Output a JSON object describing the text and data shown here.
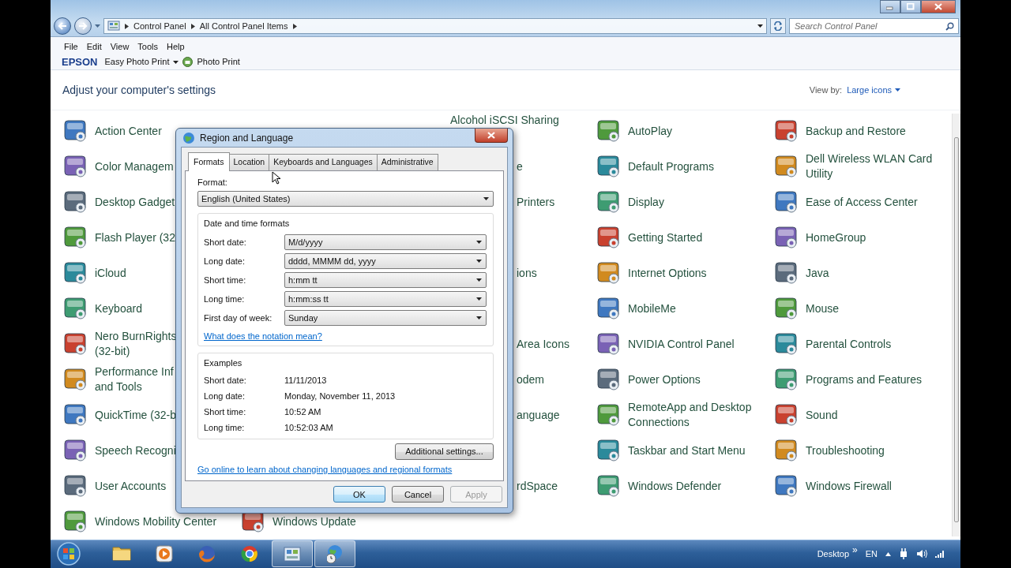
{
  "address_bar": {
    "crumbs": [
      "Control Panel",
      "All Control Panel Items"
    ],
    "search_placeholder": "Search Control Panel"
  },
  "menu": [
    "File",
    "Edit",
    "View",
    "Tools",
    "Help"
  ],
  "toolbar": {
    "brand": "EPSON",
    "items": [
      "Easy Photo Print",
      "Photo Print"
    ]
  },
  "header": {
    "title": "Adjust your computer's settings",
    "view_by_label": "View by:",
    "view_by_value": "Large icons"
  },
  "rows": [
    {
      "cells": [
        {
          "kind": "item",
          "label": "Action Center"
        },
        {
          "kind": "covered"
        },
        {
          "kind": "peek",
          "label": "Alcohol iSCSI Sharing"
        },
        {
          "kind": "item",
          "label": "AutoPlay"
        },
        {
          "kind": "item",
          "label": "Backup and Restore"
        }
      ]
    },
    {
      "cells": [
        {
          "kind": "item",
          "label": "Color Managem"
        },
        {
          "kind": "covered"
        },
        {
          "kind": "partial",
          "label": "e"
        },
        {
          "kind": "item",
          "label": "Default Programs"
        },
        {
          "kind": "item",
          "label": "Dell Wireless WLAN Card\nUtility"
        }
      ]
    },
    {
      "cells": [
        {
          "kind": "item",
          "label": "Desktop Gadget"
        },
        {
          "kind": "covered"
        },
        {
          "kind": "partial",
          "label": "Printers"
        },
        {
          "kind": "item",
          "label": "Display"
        },
        {
          "kind": "item",
          "label": "Ease of Access Center"
        }
      ]
    },
    {
      "cells": [
        {
          "kind": "item",
          "label": "Flash Player (32"
        },
        {
          "kind": "covered"
        },
        {
          "kind": "covered"
        },
        {
          "kind": "item",
          "label": "Getting Started"
        },
        {
          "kind": "item",
          "label": "HomeGroup"
        }
      ]
    },
    {
      "cells": [
        {
          "kind": "item",
          "label": "iCloud"
        },
        {
          "kind": "covered"
        },
        {
          "kind": "partial",
          "label": "ions"
        },
        {
          "kind": "item",
          "label": "Internet Options"
        },
        {
          "kind": "item",
          "label": "Java"
        }
      ]
    },
    {
      "cells": [
        {
          "kind": "item",
          "label": "Keyboard"
        },
        {
          "kind": "covered"
        },
        {
          "kind": "covered"
        },
        {
          "kind": "item",
          "label": "MobileMe"
        },
        {
          "kind": "item",
          "label": "Mouse"
        }
      ]
    },
    {
      "cells": [
        {
          "kind": "item",
          "label": "Nero BurnRights\n(32-bit)"
        },
        {
          "kind": "covered"
        },
        {
          "kind": "partial",
          "label": "Area Icons"
        },
        {
          "kind": "item",
          "label": "NVIDIA Control Panel"
        },
        {
          "kind": "item",
          "label": "Parental Controls"
        }
      ]
    },
    {
      "cells": [
        {
          "kind": "item",
          "label": "Performance Inf\nand Tools"
        },
        {
          "kind": "covered"
        },
        {
          "kind": "partial",
          "label": "odem"
        },
        {
          "kind": "item",
          "label": "Power Options"
        },
        {
          "kind": "item",
          "label": "Programs and Features"
        }
      ]
    },
    {
      "cells": [
        {
          "kind": "item",
          "label": "QuickTime (32-b"
        },
        {
          "kind": "covered"
        },
        {
          "kind": "partial",
          "label": "anguage"
        },
        {
          "kind": "item",
          "label": "RemoteApp and Desktop\nConnections"
        },
        {
          "kind": "item",
          "label": "Sound"
        }
      ]
    },
    {
      "cells": [
        {
          "kind": "item",
          "label": "Speech Recogni"
        },
        {
          "kind": "covered"
        },
        {
          "kind": "covered"
        },
        {
          "kind": "item",
          "label": "Taskbar and Start Menu"
        },
        {
          "kind": "item",
          "label": "Troubleshooting"
        }
      ]
    },
    {
      "cells": [
        {
          "kind": "item",
          "label": "User Accounts"
        },
        {
          "kind": "covered"
        },
        {
          "kind": "partial",
          "label": "rdSpace"
        },
        {
          "kind": "item",
          "label": "Windows Defender"
        },
        {
          "kind": "item",
          "label": "Windows Firewall"
        }
      ]
    },
    {
      "cells": [
        {
          "kind": "item",
          "label": "Windows Mobility Center"
        },
        {
          "kind": "item",
          "label": "Windows Update"
        }
      ]
    }
  ],
  "dialog": {
    "title": "Region and Language",
    "tabs": [
      {
        "label": "Formats",
        "selected": true
      },
      {
        "label": "Location",
        "selected": false
      },
      {
        "label": "Keyboards and Languages",
        "selected": false
      },
      {
        "label": "Administrative",
        "selected": false
      }
    ],
    "format_label": "Format:",
    "format_value": "English (United States)",
    "formats_group": {
      "title": "Date and time formats",
      "rows": [
        {
          "label": "Short date:",
          "value": "M/d/yyyy"
        },
        {
          "label": "Long date:",
          "value": "dddd, MMMM dd, yyyy"
        },
        {
          "label": "Short time:",
          "value": "h:mm tt"
        },
        {
          "label": "Long time:",
          "value": "h:mm:ss tt"
        },
        {
          "label": "First day of week:",
          "value": "Sunday"
        }
      ]
    },
    "notation_link": "What does the notation mean?",
    "examples_group": {
      "title": "Examples",
      "rows": [
        {
          "label": "Short date:",
          "value": "11/11/2013"
        },
        {
          "label": "Long date:",
          "value": "Monday, November 11, 2013"
        },
        {
          "label": "Short time:",
          "value": "10:52 AM"
        },
        {
          "label": "Long time:",
          "value": "10:52:03 AM"
        }
      ]
    },
    "additional_button": "Additional settings...",
    "online_link": "Go online to learn about changing languages and regional formats",
    "buttons": [
      {
        "label": "OK",
        "default": true,
        "disabled": false
      },
      {
        "label": "Cancel",
        "default": false,
        "disabled": false
      },
      {
        "label": "Apply",
        "default": false,
        "disabled": true
      }
    ]
  },
  "taskbar": {
    "buttons": [
      {
        "open": false
      },
      {
        "open": false
      },
      {
        "open": false
      },
      {
        "open": false
      },
      {
        "open": true
      },
      {
        "open": true
      }
    ],
    "desktop_label": "Desktop",
    "chevron": "»",
    "language": "EN"
  }
}
